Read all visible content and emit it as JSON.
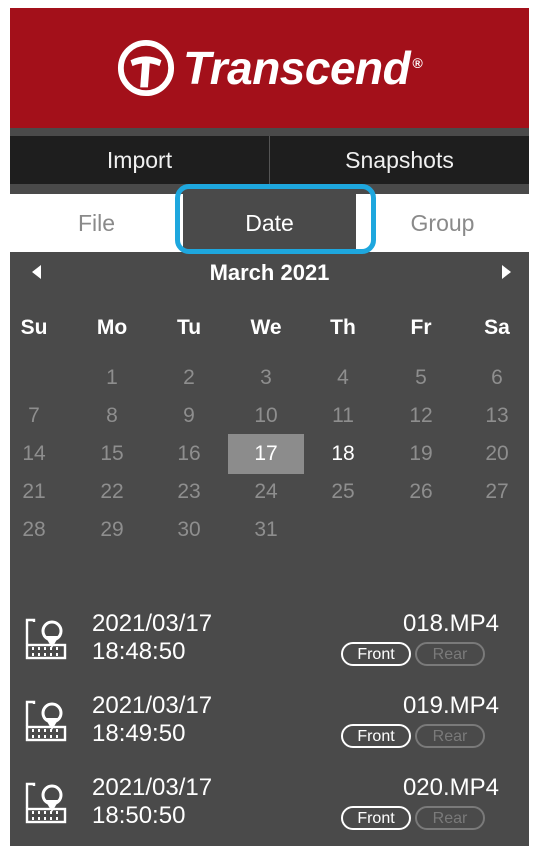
{
  "brand": {
    "name": "Transcend",
    "registered": "®"
  },
  "nav": {
    "tabs": [
      "Import",
      "Snapshots"
    ]
  },
  "subtabs": {
    "file": "File",
    "date": "Date",
    "group": "Group"
  },
  "calendar": {
    "month_title": "March 2021",
    "weekdays": [
      "Su",
      "Mo",
      "Tu",
      "We",
      "Th",
      "Fr",
      "Sa"
    ],
    "first_weekday_index": 1,
    "days_in_month": 31,
    "selected_day": 17,
    "days_with_videos": [
      17,
      18
    ]
  },
  "videos": [
    {
      "date": "2021/03/17",
      "time": "18:48:50",
      "file": "018.MP4",
      "front": "Front",
      "rear": "Rear"
    },
    {
      "date": "2021/03/17",
      "time": "18:49:50",
      "file": "019.MP4",
      "front": "Front",
      "rear": "Rear"
    },
    {
      "date": "2021/03/17",
      "time": "18:50:50",
      "file": "020.MP4",
      "front": "Front",
      "rear": "Rear"
    }
  ],
  "colors": {
    "brand_red": "#a3101a",
    "panel_bg": "#4a4a4a",
    "nav_bg": "#1e1e1e",
    "highlight_blue": "#1ea7de",
    "selected_day_bg": "#8c8c8c"
  },
  "icons": {
    "logo": "transcend-logo-icon",
    "prev": "chevron-left-icon",
    "next": "chevron-right-icon",
    "video": "video-location-icon"
  }
}
